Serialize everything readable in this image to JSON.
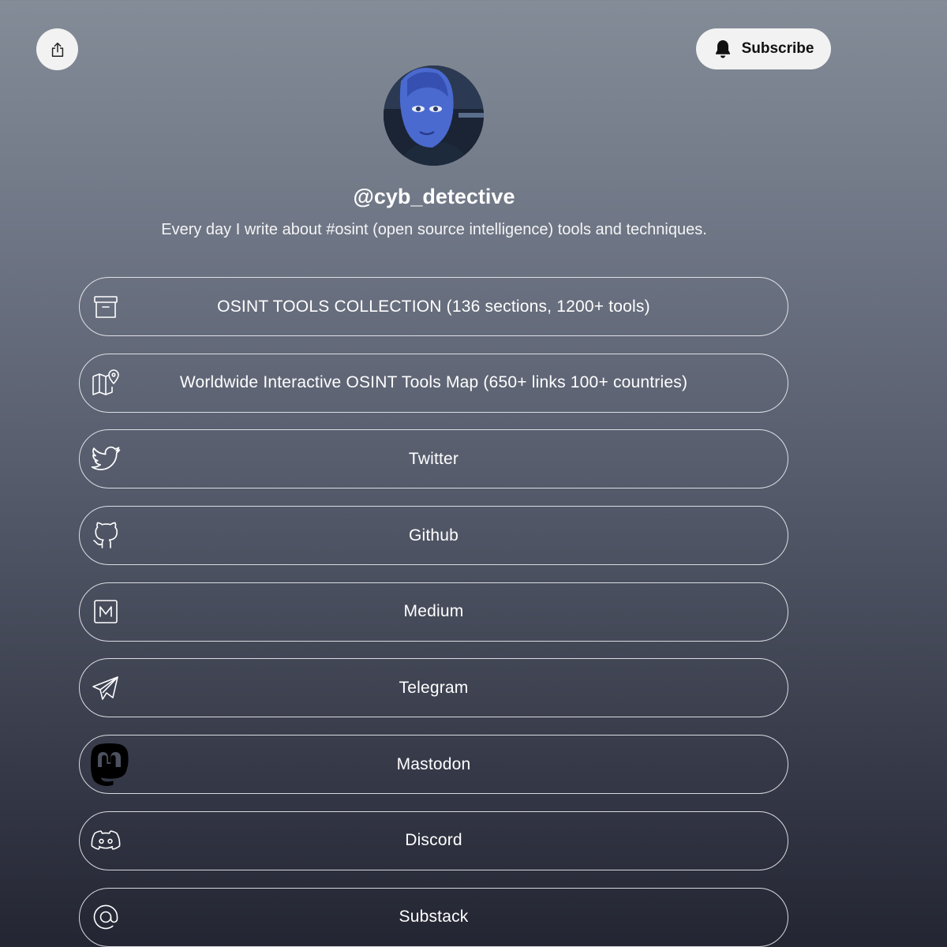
{
  "header": {
    "share_icon": "share-icon",
    "subscribe_label": "Subscribe",
    "subscribe_icon": "bell-icon"
  },
  "profile": {
    "username": "@cyb_detective",
    "bio": "Every day I write about #osint (open source intelligence) tools and techniques."
  },
  "links": [
    {
      "label": "OSINT TOOLS COLLECTION (136 sections, 1200+ tools)",
      "icon": "archive-box-icon"
    },
    {
      "label": "Worldwide Interactive OSINT Tools Map (650+ links 100+ countries)",
      "icon": "map-pin-icon"
    },
    {
      "label": "Twitter",
      "icon": "twitter-icon"
    },
    {
      "label": "Github",
      "icon": "github-icon"
    },
    {
      "label": "Medium",
      "icon": "medium-icon"
    },
    {
      "label": "Telegram",
      "icon": "telegram-icon"
    },
    {
      "label": "Mastodon",
      "icon": "mastodon-icon"
    },
    {
      "label": "Discord",
      "icon": "discord-icon"
    },
    {
      "label": "Substack",
      "icon": "at-sign-icon"
    }
  ]
}
